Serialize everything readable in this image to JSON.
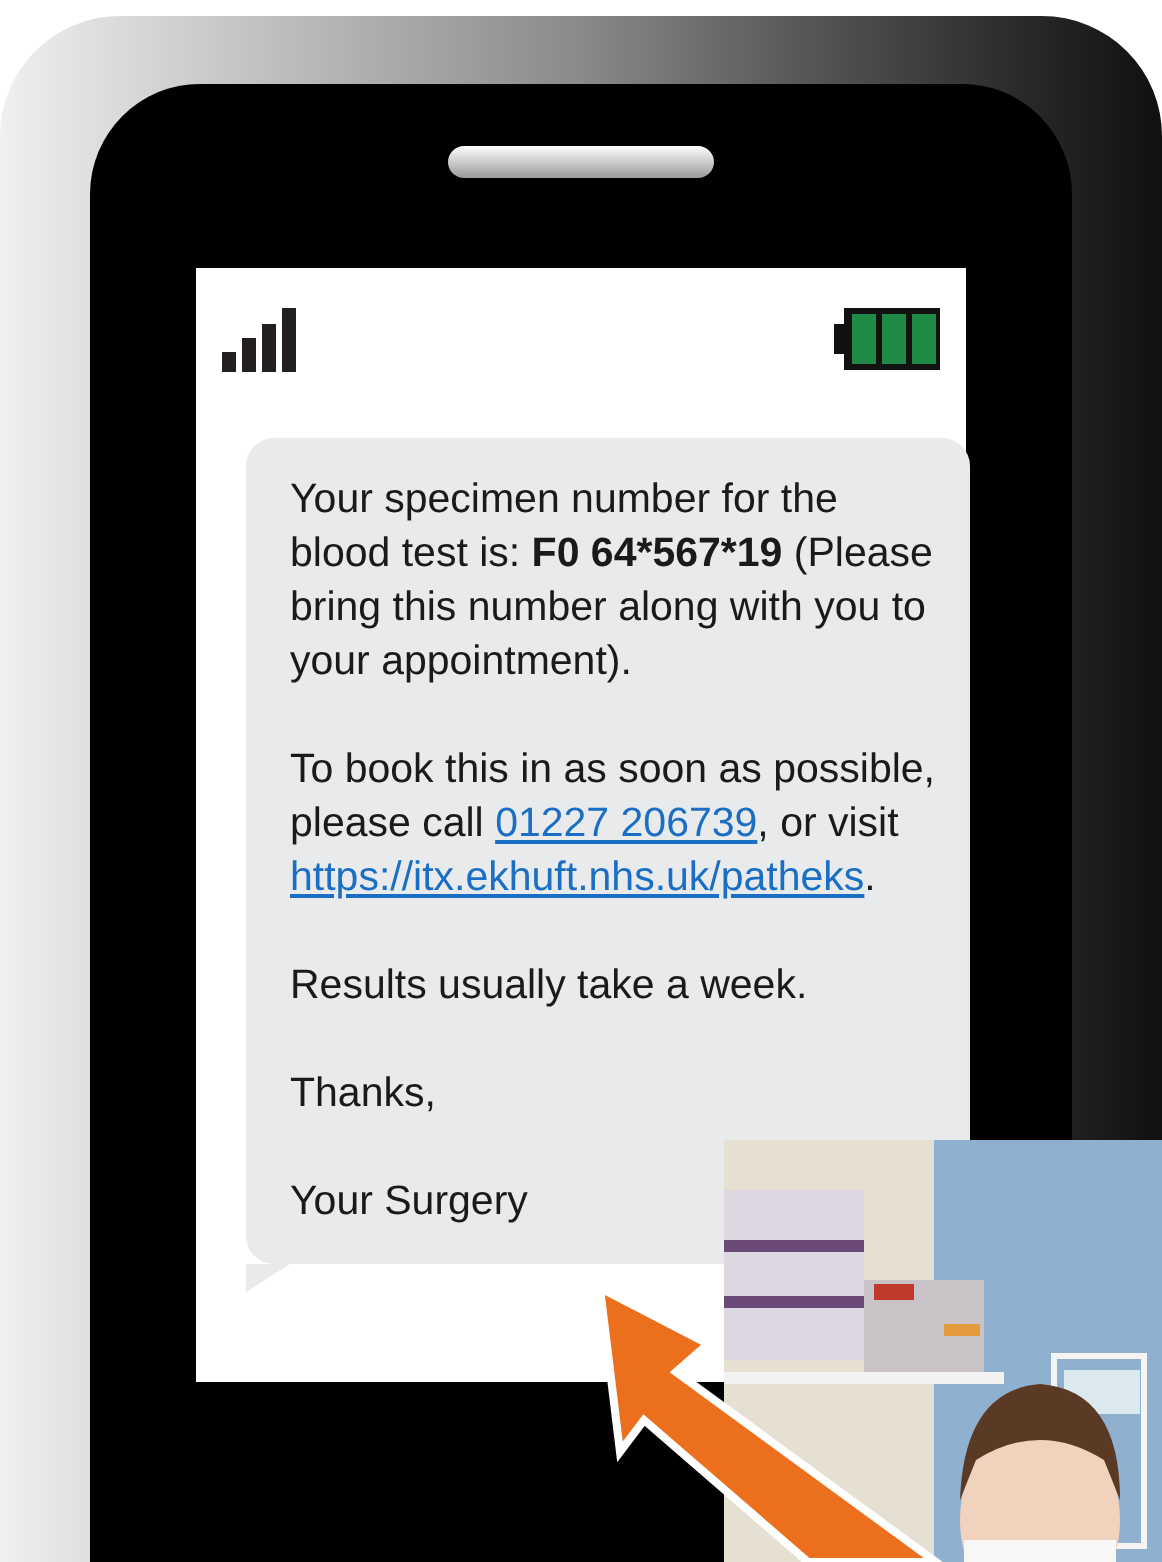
{
  "message": {
    "paragraphs": [
      [
        {
          "kind": "text",
          "text": "Your specimen number for the blood test is: "
        },
        {
          "kind": "bold",
          "text": "F0 64*567*19"
        },
        {
          "kind": "text",
          "text": " (Please bring this number along with you to your appointment)."
        }
      ],
      [
        {
          "kind": "text",
          "text": "To book this in as soon as possible, please call "
        },
        {
          "kind": "link",
          "text": "01227 206739"
        },
        {
          "kind": "text",
          "text": ", or visit "
        },
        {
          "kind": "link",
          "text": "https://itx.ekhuft.nhs.uk/patheks"
        },
        {
          "kind": "text",
          "text": "."
        }
      ],
      [
        {
          "kind": "text",
          "text": "Results usually take a week."
        }
      ],
      [
        {
          "kind": "text",
          "text": "Thanks,"
        }
      ],
      [
        {
          "kind": "text",
          "text": "Your Surgery"
        }
      ]
    ]
  }
}
